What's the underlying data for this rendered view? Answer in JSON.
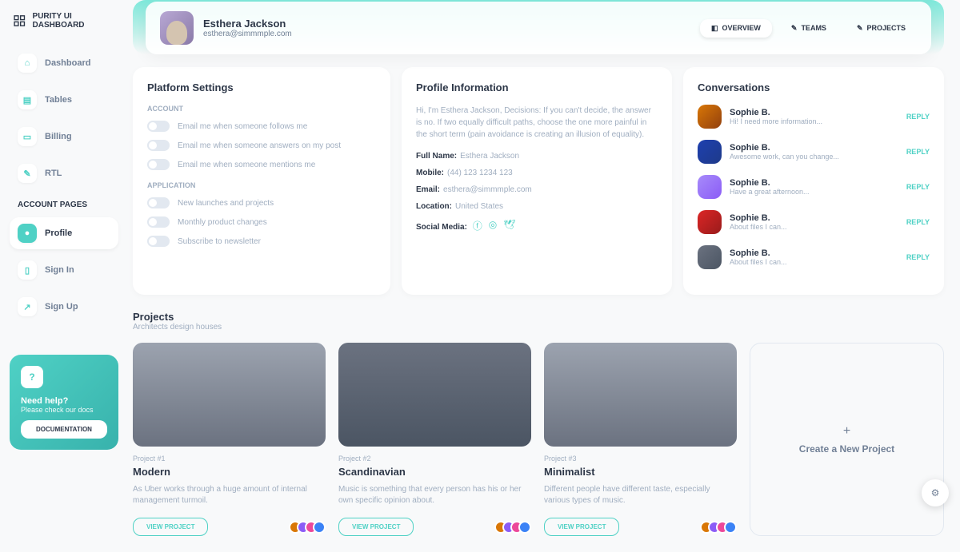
{
  "brand": "PURITY UI DASHBOARD",
  "nav": {
    "dashboard": "Dashboard",
    "tables": "Tables",
    "billing": "Billing",
    "rtl": "RTL"
  },
  "accountPagesLabel": "ACCOUNT PAGES",
  "accountNav": {
    "profile": "Profile",
    "signin": "Sign In",
    "signup": "Sign Up"
  },
  "help": {
    "title": "Need help?",
    "subtitle": "Please check our docs",
    "button": "DOCUMENTATION"
  },
  "profile": {
    "name": "Esthera Jackson",
    "email": "esthera@simmmple.com"
  },
  "tabs": {
    "overview": "OVERVIEW",
    "teams": "TEAMS",
    "projects": "PROJECTS"
  },
  "platform": {
    "title": "Platform Settings",
    "accountLabel": "ACCOUNT",
    "applicationLabel": "APPLICATION",
    "account": [
      "Email me when someone follows me",
      "Email me when someone answers on my post",
      "Email me when someone mentions me"
    ],
    "application": [
      "New launches and projects",
      "Monthly product changes",
      "Subscribe to newsletter"
    ]
  },
  "profileInfo": {
    "title": "Profile Information",
    "bio": "Hi, I'm Esthera Jackson, Decisions: If you can't decide, the answer is no. If two equally difficult paths, choose the one more painful in the short term (pain avoidance is creating an illusion of equality).",
    "rows": {
      "fullNameK": "Full Name:",
      "fullNameV": "Esthera Jackson",
      "mobileK": "Mobile:",
      "mobileV": "(44) 123 1234 123",
      "emailK": "Email:",
      "emailV": "esthera@simmmple.com",
      "locationK": "Location:",
      "locationV": "United States",
      "socialK": "Social Media:"
    }
  },
  "conversations": {
    "title": "Conversations",
    "reply": "REPLY",
    "items": [
      {
        "name": "Sophie B.",
        "msg": "Hi! I need more information..."
      },
      {
        "name": "Sophie B.",
        "msg": "Awesome work, can you change..."
      },
      {
        "name": "Sophie B.",
        "msg": "Have a great afternoon..."
      },
      {
        "name": "Sophie B.",
        "msg": "About files I can..."
      },
      {
        "name": "Sophie B.",
        "msg": "About files I can..."
      }
    ]
  },
  "projects": {
    "title": "Projects",
    "subtitle": "Architects design houses",
    "viewBtn": "VIEW PROJECT",
    "items": [
      {
        "num": "Project #1",
        "title": "Modern",
        "desc": "As Uber works through a huge amount of internal management turmoil."
      },
      {
        "num": "Project #2",
        "title": "Scandinavian",
        "desc": "Music is something that every person has his or her own specific opinion about."
      },
      {
        "num": "Project #3",
        "title": "Minimalist",
        "desc": "Different people have different taste, especially various types of music."
      }
    ],
    "newProject": "Create a New Project"
  }
}
